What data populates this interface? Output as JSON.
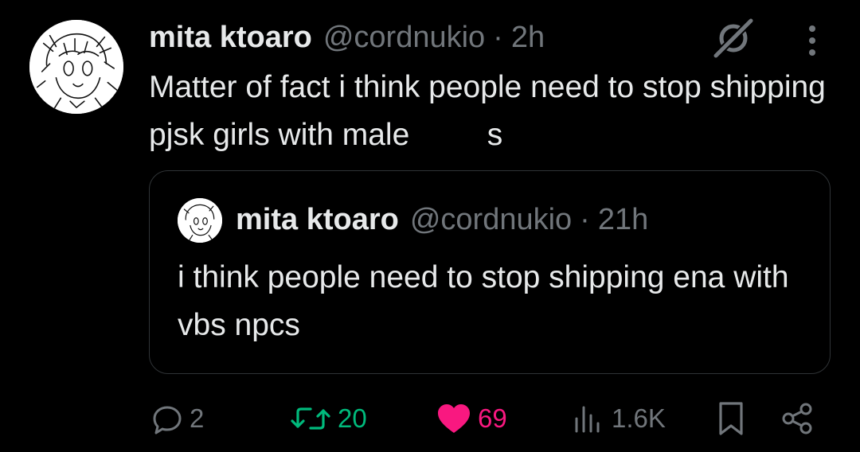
{
  "tweet": {
    "author_name": "mita ktoaro",
    "author_handle": "@cordnukio",
    "separator": "·",
    "time": "2h",
    "text": "Matter of fact i think people need to stop shipping pjsk girls with male         s"
  },
  "quote": {
    "author_name": "mita ktoaro",
    "author_handle": "@cordnukio",
    "separator": "·",
    "time": "21h",
    "text": "i think people need to stop shipping ena with vbs npcs"
  },
  "actions": {
    "replies": "2",
    "retweets": "20",
    "likes": "69",
    "views": "1.6K"
  },
  "colors": {
    "background": "#000000",
    "text": "#e7e9ea",
    "muted": "#71767b",
    "retweet_active": "#00ba7c",
    "like_active": "#f91880",
    "border": "#2f3336"
  },
  "icons": {
    "grok": "grok-icon",
    "more": "more-icon",
    "reply": "reply-icon",
    "retweet": "retweet-icon",
    "like": "heart-icon",
    "views": "views-icon",
    "bookmark": "bookmark-icon",
    "share": "share-icon"
  }
}
